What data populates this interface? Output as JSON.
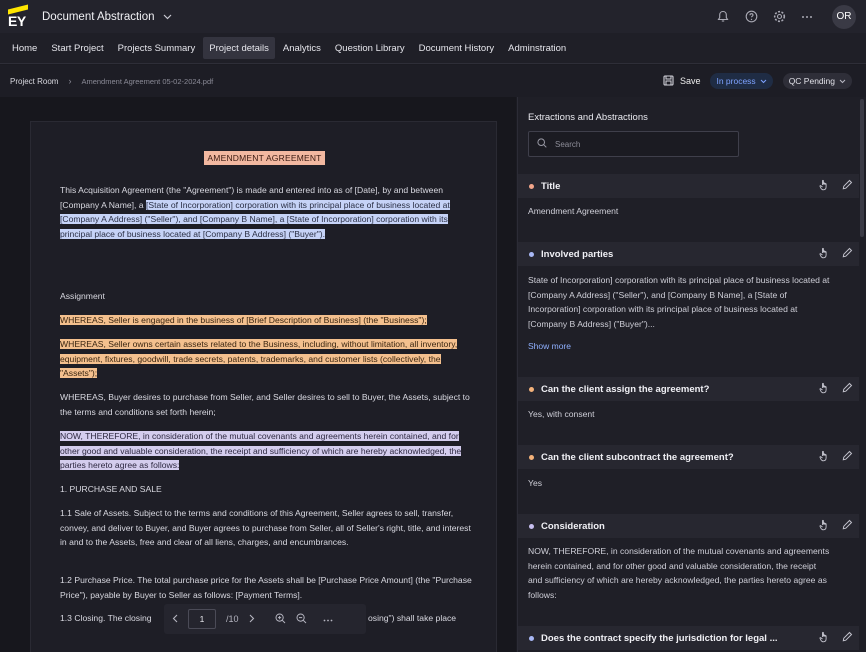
{
  "app": {
    "logo_text": "EY",
    "title": "Document Abstraction",
    "avatar_initials": "OR"
  },
  "nav": {
    "items": [
      {
        "label": "Home"
      },
      {
        "label": "Start Project"
      },
      {
        "label": "Projects Summary"
      },
      {
        "label": "Project details",
        "active": true
      },
      {
        "label": "Analytics"
      },
      {
        "label": "Question Library"
      },
      {
        "label": "Document History"
      },
      {
        "label": "Adminstration"
      }
    ]
  },
  "breadcrumb": {
    "root": "Project Room",
    "file": "Amendment Agreement 05-02-2024.pdf"
  },
  "actions": {
    "save_label": "Save",
    "status": "In process",
    "qc": "QC Pending"
  },
  "document": {
    "title": "AMENDMENT AGREEMENT",
    "p1_plain": "This Acquisition Agreement (the \"Agreement\") is made and entered into as of [Date], by and between [Company A Name], a ",
    "p1_highlight": "[State of Incorporation] corporation with its principal place of business located at [Company A Address] (\"Seller\"), and [Company B Name], a [State of Incorporation] corporation with its principal place of business located at [Company B Address] (\"Buyer\").",
    "assignment_heading": "Assignment",
    "whereas1": "WHEREAS, Seller is engaged in the business of [Brief Description of Business] (the \"Business\");",
    "whereas2": "WHEREAS, Seller owns certain assets related to the Business, including, without limitation, all inventory, equipment, fixtures, goodwill, trade secrets, patents, trademarks, and customer lists (collectively, the \"Assets\");",
    "whereas3": "WHEREAS, Buyer desires to purchase from Seller, and Seller desires to sell to Buyer, the Assets, subject to the terms and conditions set forth herein;",
    "therefore": "NOW, THEREFORE, in consideration of the mutual covenants and agreements herein contained, and for other good and valuable consideration, the receipt and sufficiency of which are hereby acknowledged, the parties hereto agree as follows:",
    "section1": "1. PURCHASE AND SALE",
    "s11": "1.1 Sale of Assets. Subject to the terms and conditions of this Agreement, Seller agrees to sell, transfer, convey, and deliver to Buyer, and Buyer agrees to purchase from Seller, all of Seller's right, title, and interest in and to the Assets, free and clear of all liens, charges, and encumbrances.",
    "s12": "1.2 Purchase Price. The total purchase price for the Assets shall be [Purchase Price Amount] (the \"Purchase Price\"), payable by Buyer to Seller as follows: [Payment Terms].",
    "s13_start": "1.3 Closing. The closing",
    "s13_end": "osing\") shall take place"
  },
  "pager": {
    "current": "1",
    "total": "/10"
  },
  "panel": {
    "title": "Extractions and Abstractions",
    "search_placeholder": "Search",
    "sections": [
      {
        "label": "Title",
        "dot": "#f2a58a",
        "answer": "Amendment Agreement"
      },
      {
        "label": "Involved parties",
        "dot": "#a9b8f5",
        "answer": "State of Incorporation] corporation with its principal place of business located at [Company A Address] (\"Seller\"), and [Company B Name], a [State of Incorporation] corporation with its principal place of business located at [Company B Address] (\"Buyer\")...",
        "more": "Show more"
      },
      {
        "label": "Can the client assign the agreement?",
        "dot": "#f4b27a",
        "answer": "Yes, with consent"
      },
      {
        "label": "Can the client subcontract the agreement?",
        "dot": "#f4b27a",
        "answer": "Yes"
      },
      {
        "label": "Consideration",
        "dot": "#c7bff0",
        "answer": "NOW, THEREFORE, in consideration of the mutual covenants and agreements herein contained, and for other good and valuable consideration, the receipt and sufficiency of which are hereby acknowledged, the parties hereto agree as follows:"
      },
      {
        "label": "Does the contract specify the jurisdiction for legal ...",
        "dot": "#a9b8f5",
        "answer": ""
      }
    ]
  }
}
